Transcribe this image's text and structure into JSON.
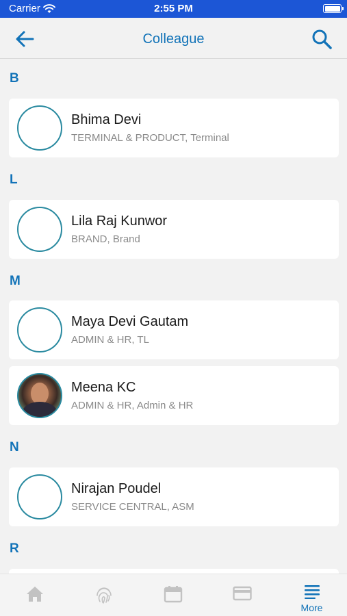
{
  "status_bar": {
    "carrier": "Carrier",
    "time": "2:55 PM"
  },
  "header": {
    "title": "Colleague",
    "back_icon": "arrow-left-icon",
    "search_icon": "search-icon"
  },
  "sections": [
    {
      "letter": "B",
      "items": [
        {
          "name": "Bhima Devi",
          "sub": "TERMINAL & PRODUCT, Terminal",
          "photo": false
        }
      ]
    },
    {
      "letter": "L",
      "items": [
        {
          "name": "Lila Raj Kunwor",
          "sub": "BRAND, Brand",
          "photo": false
        }
      ]
    },
    {
      "letter": "M",
      "items": [
        {
          "name": "Maya Devi Gautam",
          "sub": "ADMIN & HR, TL",
          "photo": false
        },
        {
          "name": "Meena KC",
          "sub": "ADMIN & HR, Admin & HR",
          "photo": true
        }
      ]
    },
    {
      "letter": "N",
      "items": [
        {
          "name": "Nirajan Poudel",
          "sub": "SERVICE CENTRAL, ASM",
          "photo": false
        }
      ]
    },
    {
      "letter": "R",
      "items": []
    }
  ],
  "tabs": [
    {
      "icon": "home-icon"
    },
    {
      "icon": "fingerprint-icon"
    },
    {
      "icon": "calendar-icon"
    },
    {
      "icon": "card-icon"
    },
    {
      "icon": "menu-icon",
      "label": "More"
    }
  ],
  "colors": {
    "accent": "#1273b8",
    "status_bar": "#1c56d6",
    "avatar_ring": "#2a8aa0",
    "tab_inactive": "#c2c2c2"
  }
}
